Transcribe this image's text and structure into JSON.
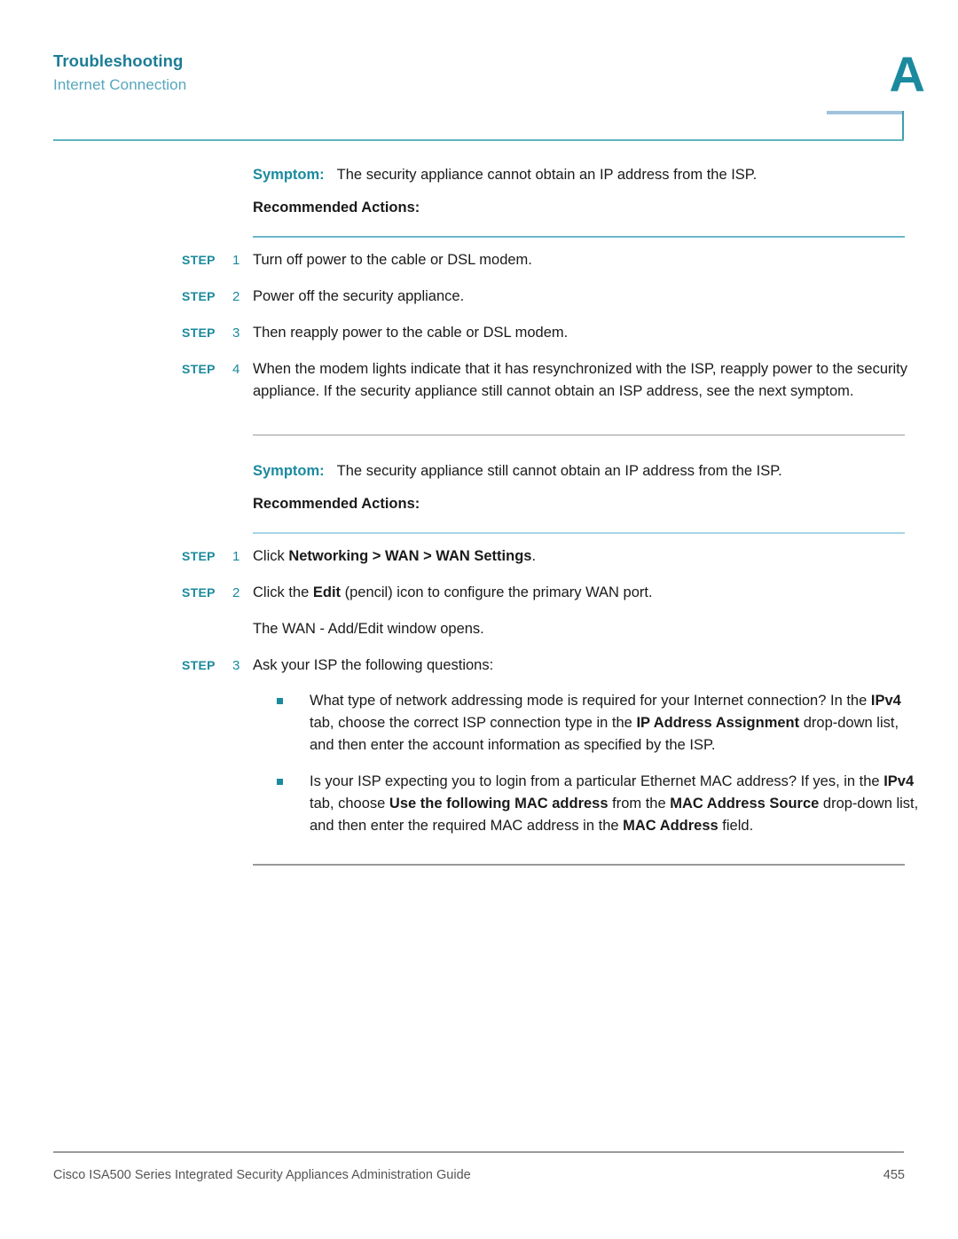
{
  "header": {
    "title": "Troubleshooting",
    "subtitle": "Internet Connection",
    "appendix_letter": "A",
    "accent_teal": "#1a8a9e",
    "title_color": "#1b7d95",
    "subtitle_color": "#55a7bd",
    "rule_color": "#5fb4c0",
    "tab_cap_color": "#9fc3dd"
  },
  "blocks": [
    {
      "symptom_label": "Symptom:",
      "symptom_text": "The security appliance cannot obtain an IP address from the ISP.",
      "recommended_actions_label": "Recommended Actions:",
      "steps": [
        {
          "tag": "STEP",
          "number": "1",
          "text": "Turn off power to the cable or DSL modem."
        },
        {
          "tag": "STEP",
          "number": "2",
          "text": "Power off the security appliance."
        },
        {
          "tag": "STEP",
          "number": "3",
          "text": "Then reapply power to the cable or DSL modem."
        },
        {
          "tag": "STEP",
          "number": "4",
          "text": "When the modem lights indicate that it has resynchronized with the ISP, reapply power to the security appliance. If the security appliance still cannot obtain an ISP address, see the next symptom."
        }
      ]
    },
    {
      "symptom_label": "Symptom:",
      "symptom_text": "The security appliance still cannot obtain an IP address from the ISP.",
      "recommended_actions_label": "Recommended Actions:",
      "steps": [
        {
          "tag": "STEP",
          "number": "1",
          "text_html": "Click <b>Networking &gt; WAN &gt; WAN Settings</b>."
        },
        {
          "tag": "STEP",
          "number": "2",
          "text_html": "Click the <b>Edit</b> (pencil) icon to configure the primary WAN port."
        },
        {
          "tag": "STEP",
          "number": "3",
          "text": "Ask your ISP the following questions:"
        }
      ],
      "step2_note": "The WAN - Add/Edit window opens.",
      "bullets": [
        {
          "text_html": "What type of network addressing mode is required for your Internet connection? In the <b>IPv4</b> tab, choose the correct ISP connection type in the <b>IP Address Assignment</b> drop-down list, and then enter the account information as specified by the ISP."
        },
        {
          "text_html": "Is your ISP expecting you to login from a particular Ethernet MAC address? If yes, in the <b>IPv4</b> tab, choose <b>Use the following MAC address</b> from the <b>MAC Address Source</b> drop-down list, and then enter the required MAC address in the <b>MAC Address</b> field."
        }
      ]
    }
  ],
  "footer": {
    "text": "Cisco ISA500 Series Integrated Security Appliances Administration Guide",
    "page_number": "455"
  }
}
